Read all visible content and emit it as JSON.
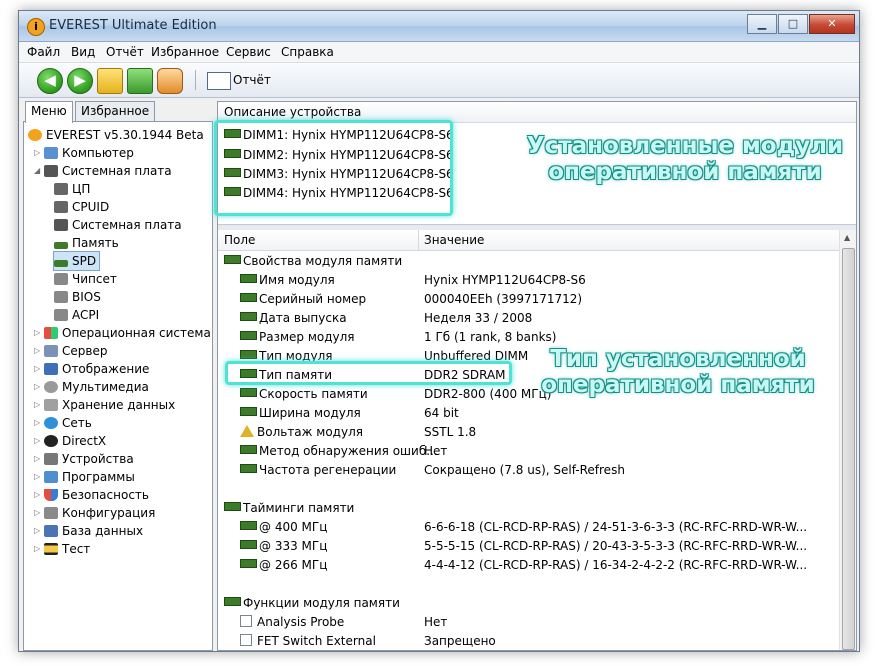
{
  "window": {
    "title": "EVEREST Ultimate Edition"
  },
  "menu": [
    "Файл",
    "Вид",
    "Отчёт",
    "Избранное",
    "Сервис",
    "Справка"
  ],
  "toolbar": {
    "report_label": "Отчёт"
  },
  "tabs": [
    "Меню",
    "Избранное"
  ],
  "tree": {
    "root": "EVEREST v5.30.1944 Beta",
    "items": [
      "Компьютер",
      "Системная плата",
      "ЦП",
      "CPUID",
      "Системная плата",
      "Память",
      "SPD",
      "Чипсет",
      "BIOS",
      "ACPI",
      "Операционная система",
      "Сервер",
      "Отображение",
      "Мультимедиа",
      "Хранение данных",
      "Сеть",
      "DirectX",
      "Устройства",
      "Программы",
      "Безопасность",
      "Конфигурация",
      "База данных",
      "Тест"
    ]
  },
  "device_description": {
    "header": "Описание устройства",
    "dimms": [
      "DIMM1: Hynix HYMP112U64CP8-S6",
      "DIMM2: Hynix HYMP112U64CP8-S6",
      "DIMM3: Hynix HYMP112U64CP8-S6",
      "DIMM4: Hynix HYMP112U64CP8-S6"
    ]
  },
  "columns": {
    "field": "Поле",
    "value": "Значение"
  },
  "sections": {
    "props": "Свойства модуля памяти",
    "timings": "Тайминги памяти",
    "functions": "Функции модуля памяти"
  },
  "props": [
    {
      "field": "Имя модуля",
      "value": "Hynix HYMP112U64CP8-S6"
    },
    {
      "field": "Серийный номер",
      "value": "000040EEh (3997171712)"
    },
    {
      "field": "Дата выпуска",
      "value": "Неделя 33 / 2008"
    },
    {
      "field": "Размер модуля",
      "value": "1 Гб (1 rank, 8 banks)"
    },
    {
      "field": "Тип модуля",
      "value": "Unbuffered DIMM"
    },
    {
      "field": "Тип памяти",
      "value": "DDR2 SDRAM"
    },
    {
      "field": "Скорость памяти",
      "value": "DDR2-800 (400 МГц)"
    },
    {
      "field": "Ширина модуля",
      "value": "64 bit"
    },
    {
      "field": "Вольтаж модуля",
      "value": "SSTL 1.8"
    },
    {
      "field": "Метод обнаружения ошиб...",
      "value": "Нет"
    },
    {
      "field": "Частота регенерации",
      "value": "Сокращено (7.8 us), Self-Refresh"
    }
  ],
  "timings": [
    {
      "field": "@ 400 МГц",
      "value": "6-6-6-18  (CL-RCD-RP-RAS) / 24-51-3-6-3-3  (RC-RFC-RRD-WR-W..."
    },
    {
      "field": "@ 333 МГц",
      "value": "5-5-5-15  (CL-RCD-RP-RAS) / 20-43-3-5-3-3  (RC-RFC-RRD-WR-W..."
    },
    {
      "field": "@ 266 МГц",
      "value": "4-4-4-12  (CL-RCD-RP-RAS) / 16-34-2-4-2-2  (RC-RFC-RRD-WR-W..."
    }
  ],
  "functions": [
    {
      "field": "Analysis Probe",
      "value": "Нет"
    },
    {
      "field": "FET Switch External",
      "value": "Запрещено"
    }
  ],
  "annotations": {
    "installed_line1": "Установленные модули",
    "installed_line2": "оперативной памяти",
    "type_line1": "Тип установленной",
    "type_line2": "оперативной памяти"
  },
  "colors": {
    "highlight": "#4fe3d8",
    "annotation_text": "#c8f8f4",
    "annotation_outline": "#168e86"
  }
}
